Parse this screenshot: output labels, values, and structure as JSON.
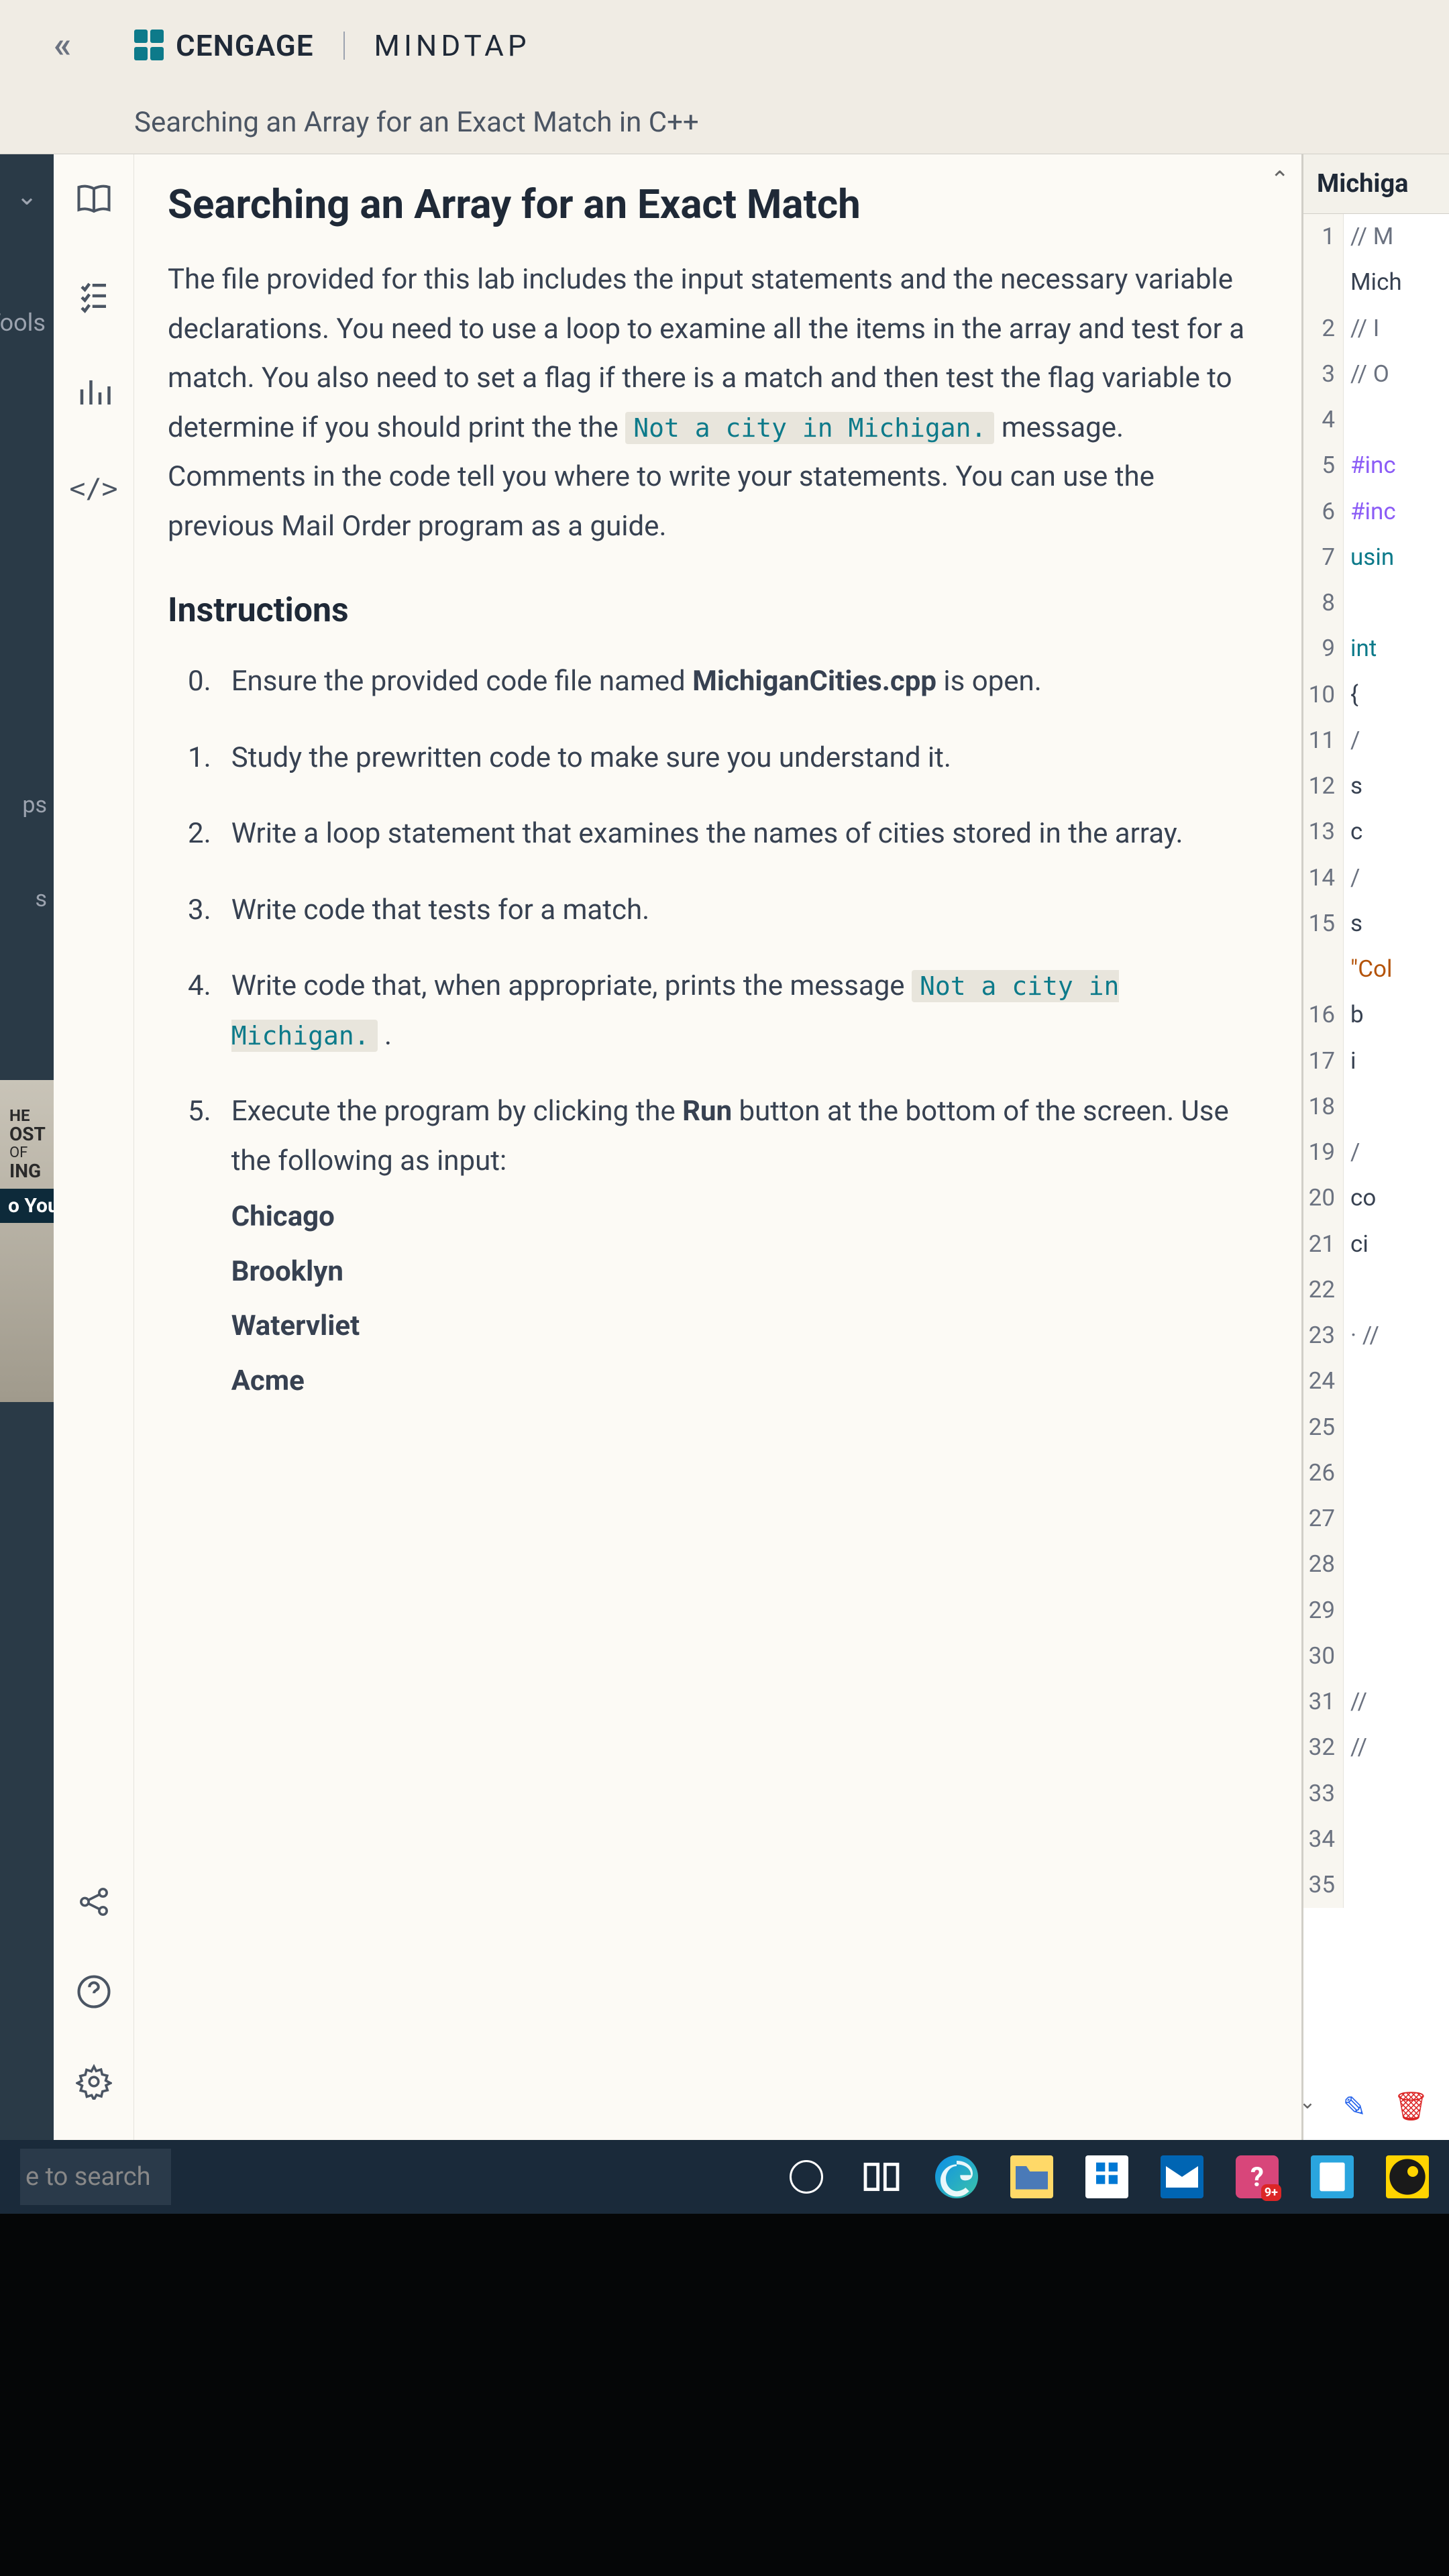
{
  "header": {
    "brand": "CENGAGE",
    "product": "MINDTAP",
    "breadcrumb": "Searching an Array for an Exact Match in C++"
  },
  "leftSidebar": {
    "toolsLabel": "Tools",
    "item1": "ps",
    "item2": "s",
    "ad": {
      "line1": "HE",
      "line2": "OST",
      "line3": "OF",
      "line4": "ING",
      "bar": "o Your"
    }
  },
  "content": {
    "title": "Searching an Array for an Exact Match",
    "paragraph_pre": "The file provided for this lab includes the input statements and the necessary variable declarations. You need to use a loop to examine all the items in the array and test for a match. You also need to set a flag if there is a match and then test the flag variable to determine if you should print the the ",
    "code_inline_1": "Not a city in Michigan.",
    "paragraph_post": " message. Comments in the code tell you where to write your statements. You can use the previous Mail Order program as a guide.",
    "instructions_h": "Instructions",
    "steps": [
      {
        "n": "0.",
        "pre": "Ensure the provided code file named ",
        "bold": "MichiganCities.cpp",
        "post": " is open."
      },
      {
        "n": "1.",
        "pre": "Study the prewritten code to make sure you understand it.",
        "bold": "",
        "post": ""
      },
      {
        "n": "2.",
        "pre": "Write a loop statement that examines the names of cities stored in the array.",
        "bold": "",
        "post": ""
      },
      {
        "n": "3.",
        "pre": "Write code that tests for a match.",
        "bold": "",
        "post": ""
      },
      {
        "n": "4.",
        "pre": "Write code that, when appropriate, prints the message ",
        "code": "Not a city in Michigan.",
        "post": " ."
      },
      {
        "n": "5.",
        "pre": "Execute the program by clicking the ",
        "bold": "Run",
        "post": " button at the bottom of the screen. Use the following as input:"
      }
    ],
    "inputs": [
      "Chicago",
      "Brooklyn",
      "Watervliet",
      "Acme"
    ]
  },
  "code": {
    "tab": "Michiga",
    "lines": [
      {
        "n": 1,
        "txt": "// M",
        "cls": "tok-comment"
      },
      {
        "n": "",
        "txt": "Mich",
        "cls": ""
      },
      {
        "n": 2,
        "txt": "// I",
        "cls": "tok-comment"
      },
      {
        "n": 3,
        "txt": "// O",
        "cls": "tok-comment"
      },
      {
        "n": 4,
        "txt": "",
        "cls": ""
      },
      {
        "n": 5,
        "txt": "#inc",
        "cls": "tok-preproc"
      },
      {
        "n": 6,
        "txt": "#inc",
        "cls": "tok-preproc"
      },
      {
        "n": 7,
        "txt": "usin",
        "cls": "tok-keyword"
      },
      {
        "n": 8,
        "txt": "",
        "cls": ""
      },
      {
        "n": 9,
        "txt": "int ",
        "cls": "tok-keyword"
      },
      {
        "n": 10,
        "txt": "{",
        "cls": ""
      },
      {
        "n": 11,
        "txt": "  /",
        "cls": "tok-comment"
      },
      {
        "n": 12,
        "txt": "  s",
        "cls": ""
      },
      {
        "n": 13,
        "txt": "  c",
        "cls": ""
      },
      {
        "n": 14,
        "txt": "  /",
        "cls": "tok-comment"
      },
      {
        "n": 15,
        "txt": "  s",
        "cls": ""
      },
      {
        "n": "",
        "txt": "\"Col",
        "cls": "tok-string"
      },
      {
        "n": 16,
        "txt": "   b",
        "cls": ""
      },
      {
        "n": 17,
        "txt": "   i",
        "cls": ""
      },
      {
        "n": 18,
        "txt": "",
        "cls": ""
      },
      {
        "n": 19,
        "txt": "   /",
        "cls": "tok-comment"
      },
      {
        "n": 20,
        "txt": "   co",
        "cls": ""
      },
      {
        "n": 21,
        "txt": "   ci",
        "cls": ""
      },
      {
        "n": 22,
        "txt": "",
        "cls": ""
      },
      {
        "n": 23,
        "txt": " · //",
        "cls": "tok-comment"
      },
      {
        "n": 24,
        "txt": "",
        "cls": ""
      },
      {
        "n": 25,
        "txt": "",
        "cls": ""
      },
      {
        "n": 26,
        "txt": "",
        "cls": ""
      },
      {
        "n": 27,
        "txt": "",
        "cls": ""
      },
      {
        "n": 28,
        "txt": "",
        "cls": ""
      },
      {
        "n": 29,
        "txt": "",
        "cls": ""
      },
      {
        "n": 30,
        "txt": "",
        "cls": ""
      },
      {
        "n": 31,
        "txt": "   //",
        "cls": "tok-comment"
      },
      {
        "n": 32,
        "txt": "   //",
        "cls": "tok-comment"
      },
      {
        "n": 33,
        "txt": "",
        "cls": ""
      },
      {
        "n": 34,
        "txt": "",
        "cls": ""
      },
      {
        "n": 35,
        "txt": "",
        "cls": ""
      }
    ]
  },
  "taskbar": {
    "search": "e to search",
    "badge": "9+"
  }
}
